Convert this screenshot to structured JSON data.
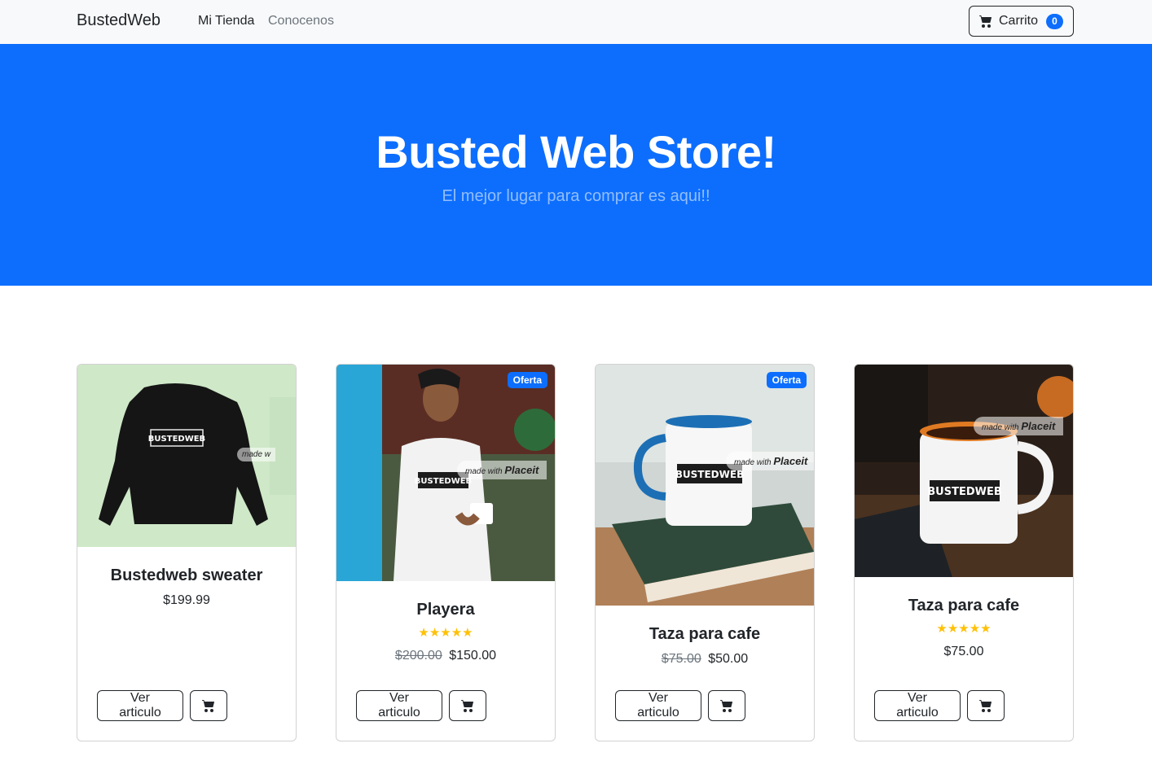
{
  "navbar": {
    "brand": "BustedWeb",
    "links": [
      "Mi Tienda",
      "Conocenos"
    ],
    "cart_label": "Carrito",
    "cart_count": "0",
    "cart_icon": "cart-icon"
  },
  "hero": {
    "title": "Busted Web Store!",
    "subtitle": "El mejor lugar para comprar es aqui!!"
  },
  "colors": {
    "primary": "#0d6efd",
    "navbar_bg": "#f8f9fa",
    "star": "#ffc107"
  },
  "products": [
    {
      "name": "Bustedweb sweater",
      "price": "$199.99",
      "old_price": "",
      "badge": "",
      "rating": 0,
      "stars": "",
      "view_label": "Ver articulo",
      "watermark_text": "made w",
      "watermark_brand": ""
    },
    {
      "name": "Playera",
      "price": "$150.00",
      "old_price": "$200.00",
      "badge": "Oferta",
      "rating": 5,
      "stars": "★★★★★",
      "view_label": "Ver articulo",
      "watermark_text": "made with",
      "watermark_brand": "Placeit"
    },
    {
      "name": "Taza para cafe",
      "price": "$50.00",
      "old_price": "$75.00",
      "badge": "Oferta",
      "rating": 0,
      "stars": "",
      "view_label": "Ver articulo",
      "watermark_text": "made with",
      "watermark_brand": "Placeit"
    },
    {
      "name": "Taza para cafe",
      "price": "$75.00",
      "old_price": "",
      "badge": "",
      "rating": 5,
      "stars": "★★★★★",
      "view_label": "Ver articulo",
      "watermark_text": "made with",
      "watermark_brand": "Placeit"
    }
  ],
  "product_print": "BUSTEDWEB"
}
